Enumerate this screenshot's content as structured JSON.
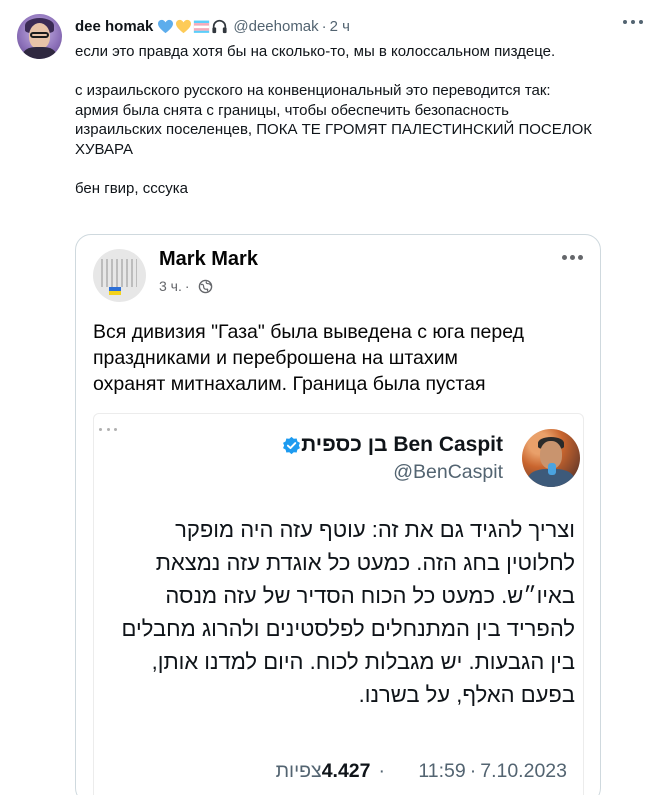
{
  "post": {
    "author_name": "dee homak",
    "emojis": [
      "blue-heart-icon",
      "yellow-heart-icon",
      "transgender-flag-icon",
      "headphones-icon"
    ],
    "handle": "@deehomak",
    "separator": "·",
    "time": "2 ч",
    "text_lines": [
      "если это правда хотя бы на сколько-то, мы в колоссальном пиздеце.",
      "",
      "с израильского русского на конвенциональный это переводится так:",
      "армия была снята с границы, чтобы обеспечить безопасность",
      "израильских поселенцев, ПОКА ТЕ ГРОМЯТ ПАЛЕСТИНСКИЙ ПОСЕЛОК",
      "ХУВАРА",
      "",
      "бен гвир, сссука"
    ]
  },
  "quote": {
    "author_name": "Mark Mark",
    "time": "3 ч.",
    "separator": "·",
    "text_lines": [
      "Вся дивизия \"Газа\" была выведена с юга перед",
      "праздниками и переброшена на штахим",
      "охранят митнахалим. Граница была пустая"
    ]
  },
  "embedded_tweet": {
    "display_name": "Ben Caspit בן כספית",
    "handle": "@BenCaspit",
    "text_lines": [
      "וצריך להגיד גם את זה: עוטף עזה היה מופקר",
      "לחלוטין בחג הזה. כמעט כל אוגדת עזה נמצאת",
      "באיו״ש. כמעט כל הכוח הסדיר של עזה מנסה",
      "להפריד בין המתנחלים לפלסטינים ולהרוג מחבלים",
      "בין הגבעות. יש מגבלות לכוח. היום למדנו אותן,",
      "בפעם האלף, על בשרנו."
    ],
    "date": "7.10.2023",
    "time": "11:59",
    "separator": "·",
    "views_count": "4.427",
    "views_label": "צפיות"
  },
  "colors": {
    "text": "#0f1419",
    "muted": "#536471",
    "border": "#cfd9de",
    "verified": "#1d9bf0"
  }
}
